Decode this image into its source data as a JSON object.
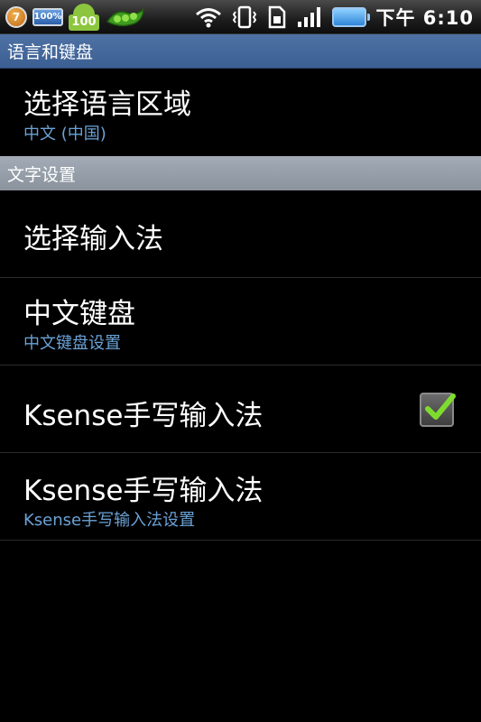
{
  "status_bar": {
    "badge_number": "7",
    "battery_small_label": "100%",
    "android_number": "100",
    "time": "下午 6:10",
    "icons": [
      "badge-icon",
      "battery-small-icon",
      "android-icon",
      "peas-icon",
      "wifi-icon",
      "vibrate-icon",
      "sim-icon",
      "signal-icon",
      "battery-icon"
    ]
  },
  "sections": {
    "language_keyboard": "语言和键盘",
    "text_settings": "文字设置"
  },
  "items": {
    "select_locale": {
      "title": "选择语言区域",
      "subtitle": "中文 (中国)"
    },
    "select_input": {
      "title": "选择输入法"
    },
    "chinese_keyboard": {
      "title": "中文键盘",
      "subtitle": "中文键盘设置"
    },
    "ksense_toggle": {
      "title": "Ksense手写输入法",
      "checked": true
    },
    "ksense_settings": {
      "title": "Ksense手写输入法",
      "subtitle": "Ksense手写输入法设置"
    }
  },
  "colors": {
    "header_blue": "#4f72a4",
    "header_gray": "#9aa3ad",
    "subtitle_blue": "#6aa2d6",
    "check_green": "#7fdc2e"
  }
}
